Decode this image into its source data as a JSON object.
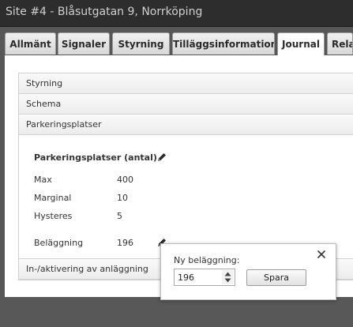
{
  "window": {
    "title": "Site #4 - Blåsutgatan 9, Norrköping"
  },
  "tabs": [
    {
      "label": "Allmänt"
    },
    {
      "label": "Signaler"
    },
    {
      "label": "Styrning"
    },
    {
      "label": "Tilläggsinformation"
    },
    {
      "label": "Journal"
    },
    {
      "label": "Relat"
    }
  ],
  "accordion": {
    "sections": [
      {
        "label": "Styrning"
      },
      {
        "label": "Schema"
      },
      {
        "label": "Parkeringsplatser"
      },
      {
        "label": "In-/aktivering av anläggning"
      }
    ],
    "parking": {
      "heading": "Parkeringsplatser (antal)",
      "rows": [
        {
          "label": "Max",
          "value": "400"
        },
        {
          "label": "Marginal",
          "value": "10"
        },
        {
          "label": "Hysteres",
          "value": "5"
        },
        {
          "label": "Beläggning",
          "value": "196"
        }
      ]
    }
  },
  "popup": {
    "label": "Ny beläggning:",
    "value": "196",
    "save_label": "Spara"
  },
  "icons": {
    "edit": "pencil-icon",
    "close": "close-icon",
    "spinner": "spinner-arrows-icon"
  }
}
